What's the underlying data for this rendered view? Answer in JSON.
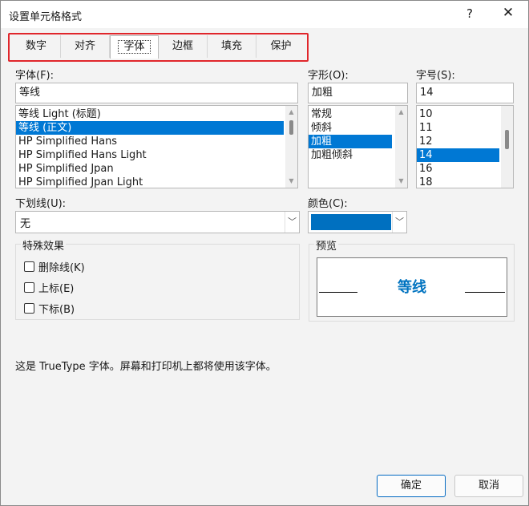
{
  "window": {
    "title": "设置单元格格式",
    "help_label": "?",
    "close_label": "✕"
  },
  "tabs": [
    {
      "label": "数字"
    },
    {
      "label": "对齐"
    },
    {
      "label": "字体"
    },
    {
      "label": "边框"
    },
    {
      "label": "填充"
    },
    {
      "label": "保护"
    }
  ],
  "active_tab": "字体",
  "font": {
    "label": "字体(F):",
    "value": "等线",
    "items": [
      "等线 Light (标题)",
      "等线 (正文)",
      "HP Simplified Hans",
      "HP Simplified Hans Light",
      "HP Simplified Jpan",
      "HP Simplified Jpan Light"
    ],
    "selected": "等线 (正文)"
  },
  "style": {
    "label": "字形(O):",
    "value": "加粗",
    "items": [
      "常规",
      "倾斜",
      "加粗",
      "加粗倾斜"
    ],
    "selected": "加粗"
  },
  "size": {
    "label": "字号(S):",
    "value": "14",
    "items": [
      "10",
      "11",
      "12",
      "14",
      "16",
      "18"
    ],
    "selected": "14"
  },
  "underline": {
    "label": "下划线(U):",
    "value": "无"
  },
  "color": {
    "label": "颜色(C):",
    "value_color": "#0070c0"
  },
  "effects": {
    "label": "特殊效果",
    "items": [
      {
        "label": "删除线(K)",
        "checked": false
      },
      {
        "label": "上标(E)",
        "checked": false
      },
      {
        "label": "下标(B)",
        "checked": false
      }
    ]
  },
  "preview": {
    "label": "预览",
    "text": "等线",
    "text_color": "#0073c0"
  },
  "info_text": "这是 TrueType 字体。屏幕和打印机上都将使用该字体。",
  "buttons": {
    "ok": "确定",
    "cancel": "取消"
  },
  "highlight_color": "#e0262b",
  "selection_color": "#0078d4"
}
